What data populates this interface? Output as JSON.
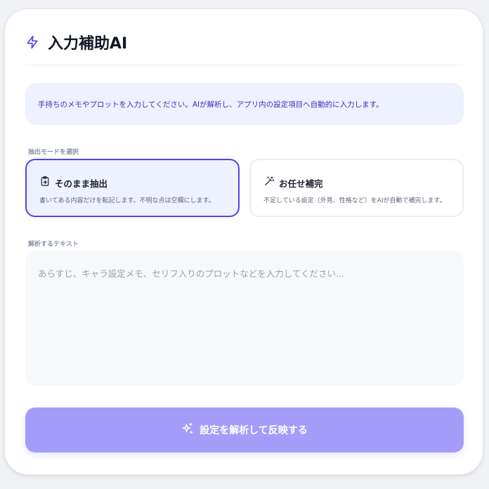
{
  "header": {
    "title": "入力補助AI",
    "icon": "lightning-icon",
    "accent_color": "#4f46e5"
  },
  "info": {
    "text": "手持ちのメモやプロットを入力してください。AIが解析し、アプリ内の設定項目へ自動的に入力します。"
  },
  "mode_section": {
    "label": "抽出モードを選択",
    "options": [
      {
        "title": "そのまま抽出",
        "description": "書いてある内容だけを転記します。不明な点は空欄にします。",
        "icon": "clipboard-icon",
        "selected": true
      },
      {
        "title": "お任せ補完",
        "description": "不足している設定（外見、性格など）をAIが自動で補完します。",
        "icon": "magic-wand-icon",
        "selected": false
      }
    ]
  },
  "text_section": {
    "label": "解析するテキスト",
    "placeholder": "あらすじ、キャラ設定メモ、セリフ入りのプロットなどを入力してください...",
    "value": ""
  },
  "submit": {
    "label": "設定を解析して反映する",
    "icon": "sparkles-icon",
    "color": "#a59cfa"
  }
}
